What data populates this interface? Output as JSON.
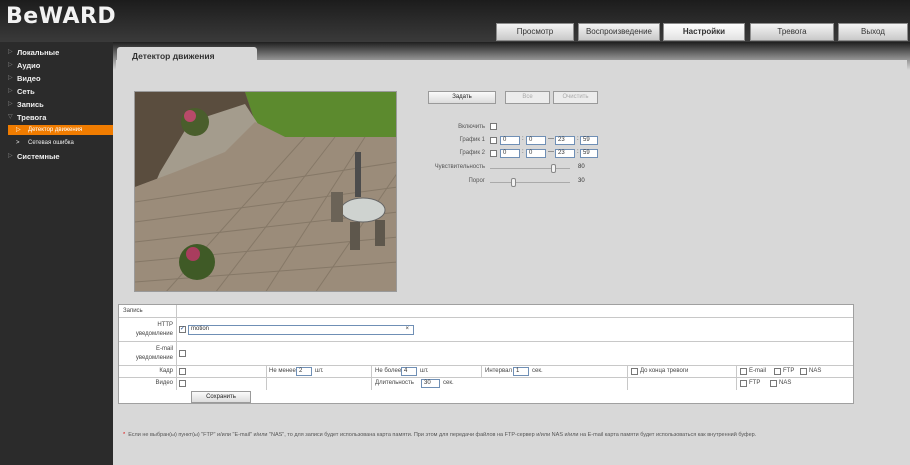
{
  "app": {
    "logo": "BeWARD"
  },
  "top_tabs": [
    {
      "label": "Просмотр"
    },
    {
      "label": "Воспроизведение"
    },
    {
      "label": "Настройки",
      "active": true
    },
    {
      "label": "Тревога"
    },
    {
      "label": "Выход"
    }
  ],
  "sidebar": {
    "items": [
      {
        "label": "Локальные"
      },
      {
        "label": "Аудио"
      },
      {
        "label": "Видео"
      },
      {
        "label": "Сеть"
      },
      {
        "label": "Запись"
      },
      {
        "label": "Тревога",
        "expanded": true
      },
      {
        "label": "Системные"
      }
    ],
    "sub_items": [
      {
        "label": "Детектор движения",
        "active": true
      },
      {
        "label": "Сетевая ошибка"
      }
    ]
  },
  "page_tab": {
    "label": "Детектор движения"
  },
  "detector": {
    "buttons": {
      "set": "Задать",
      "all": "Все",
      "clear": "Очистить"
    },
    "enable_label": "Включить",
    "enabled": false,
    "schedule1": {
      "label": "График 1",
      "enabled": false,
      "from_h": "0",
      "from_m": "0",
      "to_h": "23",
      "to_m": "59"
    },
    "schedule2": {
      "label": "График 2",
      "enabled": false,
      "from_h": "0",
      "from_m": "0",
      "to_h": "23",
      "to_m": "59"
    },
    "sensitivity": {
      "label": "Чувствительность",
      "value": "80",
      "fraction": 0.8
    },
    "threshold": {
      "label": "Порог",
      "value": "30",
      "fraction": 0.3
    }
  },
  "record": {
    "title": "Запись",
    "http": {
      "label": "HTTP уведомление",
      "checked": true,
      "value": "motion",
      "clear": "×"
    },
    "email": {
      "label": "E-mail уведомление",
      "checked": false
    },
    "frame": {
      "label": "Кадр",
      "min_label": "Не менее",
      "min_value": "2",
      "min_unit": "шт.",
      "max_label": "Не более",
      "max_value": "4",
      "max_unit": "шт.",
      "interval_label": "Интервал",
      "interval_value": "1",
      "interval_unit": "сек.",
      "till_end": "До конца тревоги",
      "opt_email": "E-mail",
      "opt_ftp": "FTP",
      "opt_nas": "NAS"
    },
    "video": {
      "label": "Видео",
      "duration_label": "Длительность",
      "duration_value": "30",
      "duration_unit": "сек.",
      "opt_ftp": "FTP",
      "opt_nas": "NAS"
    },
    "save": "Сохранить"
  },
  "note": {
    "star": "*",
    "text": "Если не выбран(ы) пункт(ы) \"FTP\" и/или \"E-mail\" и/или \"NAS\", то для записи будет использована карта памяти. При этом для передачи файлов на FTP-сервер и/или NAS и/или на E-mail карта памяти будет использоваться как внутренний буфер."
  },
  "colors": {
    "accent": "#f07c00",
    "header": "#2b2b2b",
    "panel": "#d8d8d8"
  }
}
